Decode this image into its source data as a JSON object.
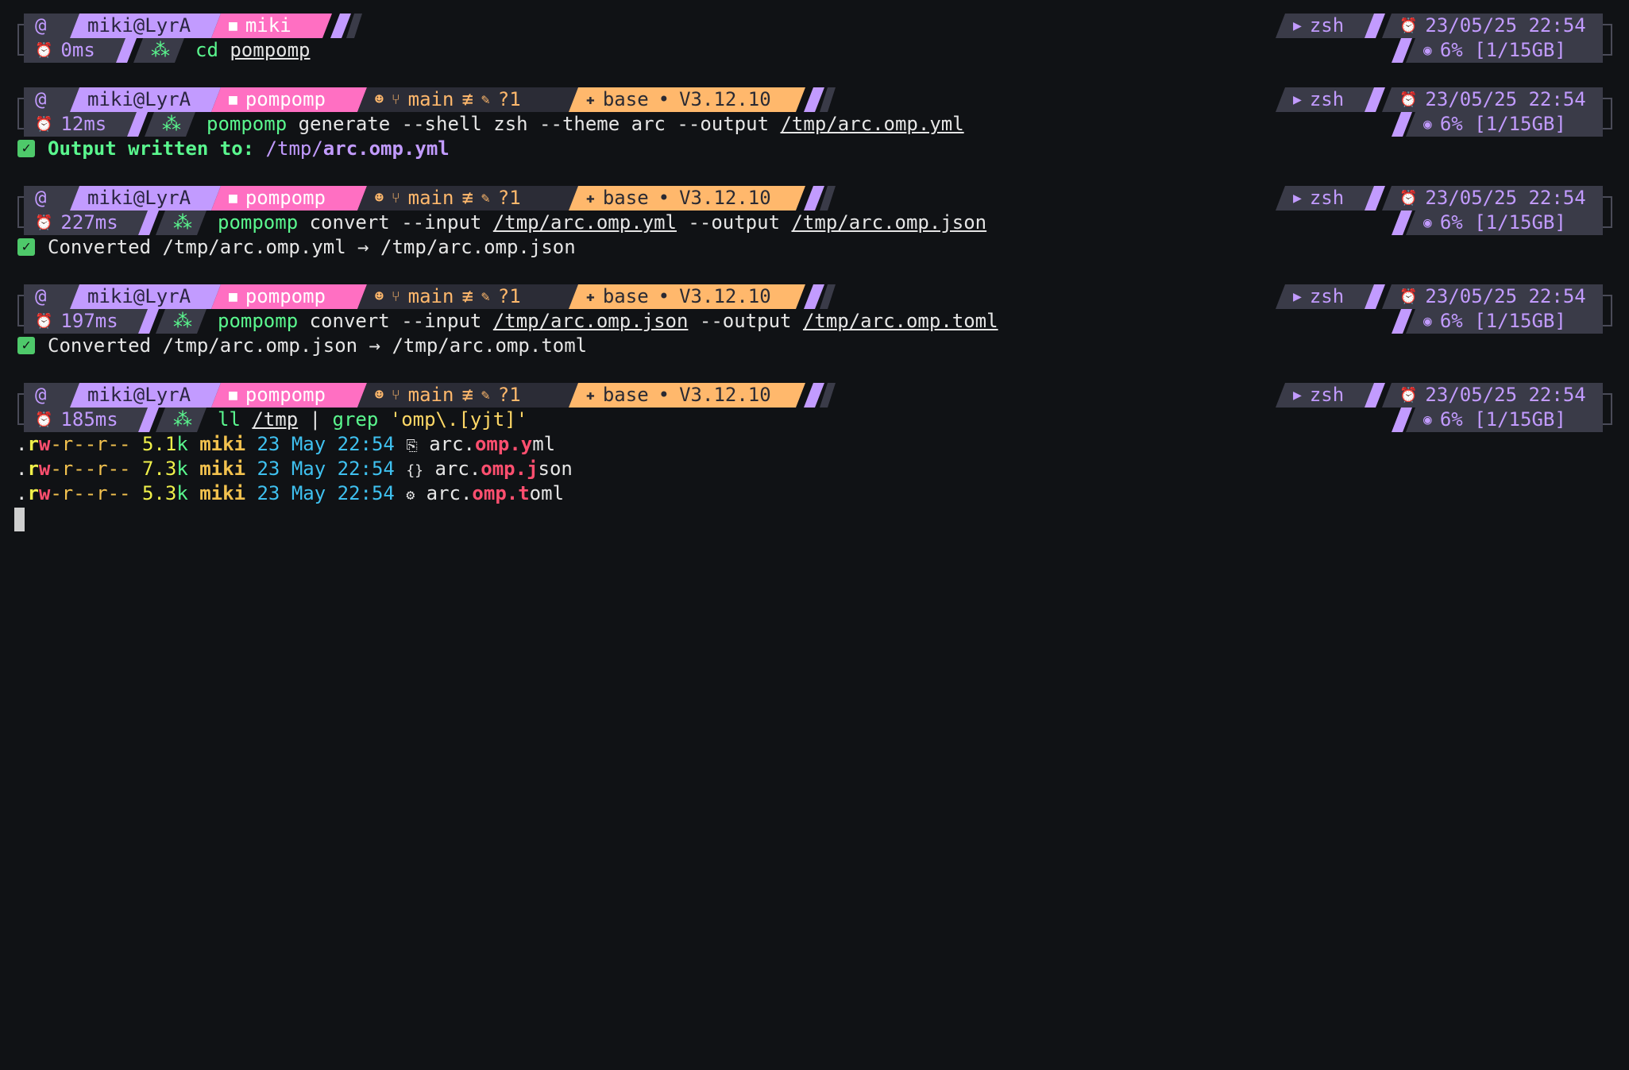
{
  "prompt_common": {
    "os_icon": "debian-swirl-icon",
    "user_host": "miki@LyrA",
    "shell": "zsh",
    "datetime": "23/05/25 22:54",
    "memory": "6% [1/15GB]",
    "git_branch": "main",
    "git_status": "?1",
    "env_label": "base",
    "python_version": "V3.12.10",
    "bullet": "•",
    "colors": {
      "background": "#101215",
      "lavender": "#c29bff",
      "pink": "#ff6fc2",
      "orange": "#ffb86c",
      "dark": "#3a3b48",
      "green": "#5af78e"
    }
  },
  "blocks": [
    {
      "dir": "miki",
      "duration": "0ms",
      "cmd": {
        "name": "cd",
        "args": [
          "pompomp"
        ]
      }
    },
    {
      "dir": "pompomp",
      "duration": "12ms",
      "cmd": {
        "name": "pompomp",
        "p1": " generate --shell zsh --theme arc --output ",
        "path1": "/tmp/arc.omp.yml"
      },
      "output": {
        "label": "Output written to:",
        "dir": "/tmp/",
        "file": "arc.omp.yml"
      }
    },
    {
      "dir": "pompomp",
      "duration": "227ms",
      "cmd": {
        "name": "pompomp",
        "p1": " convert --input ",
        "path1": "/tmp/arc.omp.yml",
        "p2": " --output ",
        "path2": "/tmp/arc.omp.json"
      },
      "output": {
        "text": "Converted /tmp/arc.omp.yml → /tmp/arc.omp.json"
      }
    },
    {
      "dir": "pompomp",
      "duration": "197ms",
      "cmd": {
        "name": "pompomp",
        "p1": " convert --input ",
        "path1": "/tmp/arc.omp.json",
        "p2": " --output ",
        "path2": "/tmp/arc.omp.toml"
      },
      "output": {
        "text": "Converted /tmp/arc.omp.json → /tmp/arc.omp.toml"
      }
    },
    {
      "dir": "pompomp",
      "duration": "185ms",
      "cmd": {
        "name": "ll",
        "path1": "/tmp",
        "pipe": " | ",
        "grep": "grep",
        "pattern": " 'omp\\.[yjt]'"
      }
    }
  ],
  "listing": [
    {
      "dot": ".",
      "r": "r",
      "w": "w",
      "rest": "-r--r--",
      "size_num": "5.1",
      "size_unit": "k",
      "user": "miki",
      "date": "23 May 22:54",
      "icon": "yaml-file-icon",
      "icon_char": "⎘",
      "name_a": "arc.",
      "name_b": "omp.",
      "name_c": "y",
      "name_d": "ml"
    },
    {
      "dot": ".",
      "r": "r",
      "w": "w",
      "rest": "-r--r--",
      "size_num": "7.3",
      "size_unit": "k",
      "user": "miki",
      "date": "23 May 22:54",
      "icon": "json-file-icon",
      "icon_char": "{}",
      "name_a": "arc.",
      "name_b": "omp.",
      "name_c": "j",
      "name_d": "son"
    },
    {
      "dot": ".",
      "r": "r",
      "w": "w",
      "rest": "-r--r--",
      "size_num": "5.3",
      "size_unit": "k",
      "user": "miki",
      "date": "23 May 22:54",
      "icon": "toml-gear-icon",
      "icon_char": "⚙",
      "name_a": "arc.",
      "name_b": "omp.",
      "name_c": "t",
      "name_d": "oml"
    }
  ]
}
